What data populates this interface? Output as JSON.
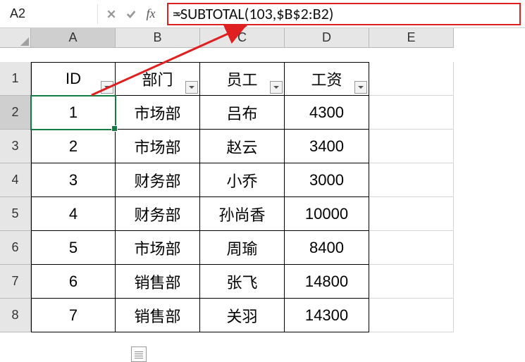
{
  "formulaBar": {
    "nameBox": "A2",
    "formula": "=SUBTOTAL(103,$B$2:B2)"
  },
  "columns": [
    "A",
    "B",
    "C",
    "D",
    "E"
  ],
  "rows": [
    "1",
    "2",
    "3",
    "4",
    "5",
    "6",
    "7",
    "8"
  ],
  "table": {
    "headers": {
      "A": "ID",
      "B": "部门",
      "C": "员工",
      "D": "工资"
    },
    "data": [
      {
        "A": "1",
        "B": "市场部",
        "C": "吕布",
        "D": "4300"
      },
      {
        "A": "2",
        "B": "市场部",
        "C": "赵云",
        "D": "3400"
      },
      {
        "A": "3",
        "B": "财务部",
        "C": "小乔",
        "D": "3000"
      },
      {
        "A": "4",
        "B": "财务部",
        "C": "孙尚香",
        "D": "10000"
      },
      {
        "A": "5",
        "B": "市场部",
        "C": "周瑜",
        "D": "8400"
      },
      {
        "A": "6",
        "B": "销售部",
        "C": "张飞",
        "D": "14800"
      },
      {
        "A": "7",
        "B": "销售部",
        "C": "关羽",
        "D": "14300"
      }
    ]
  },
  "selectedCell": "A2"
}
